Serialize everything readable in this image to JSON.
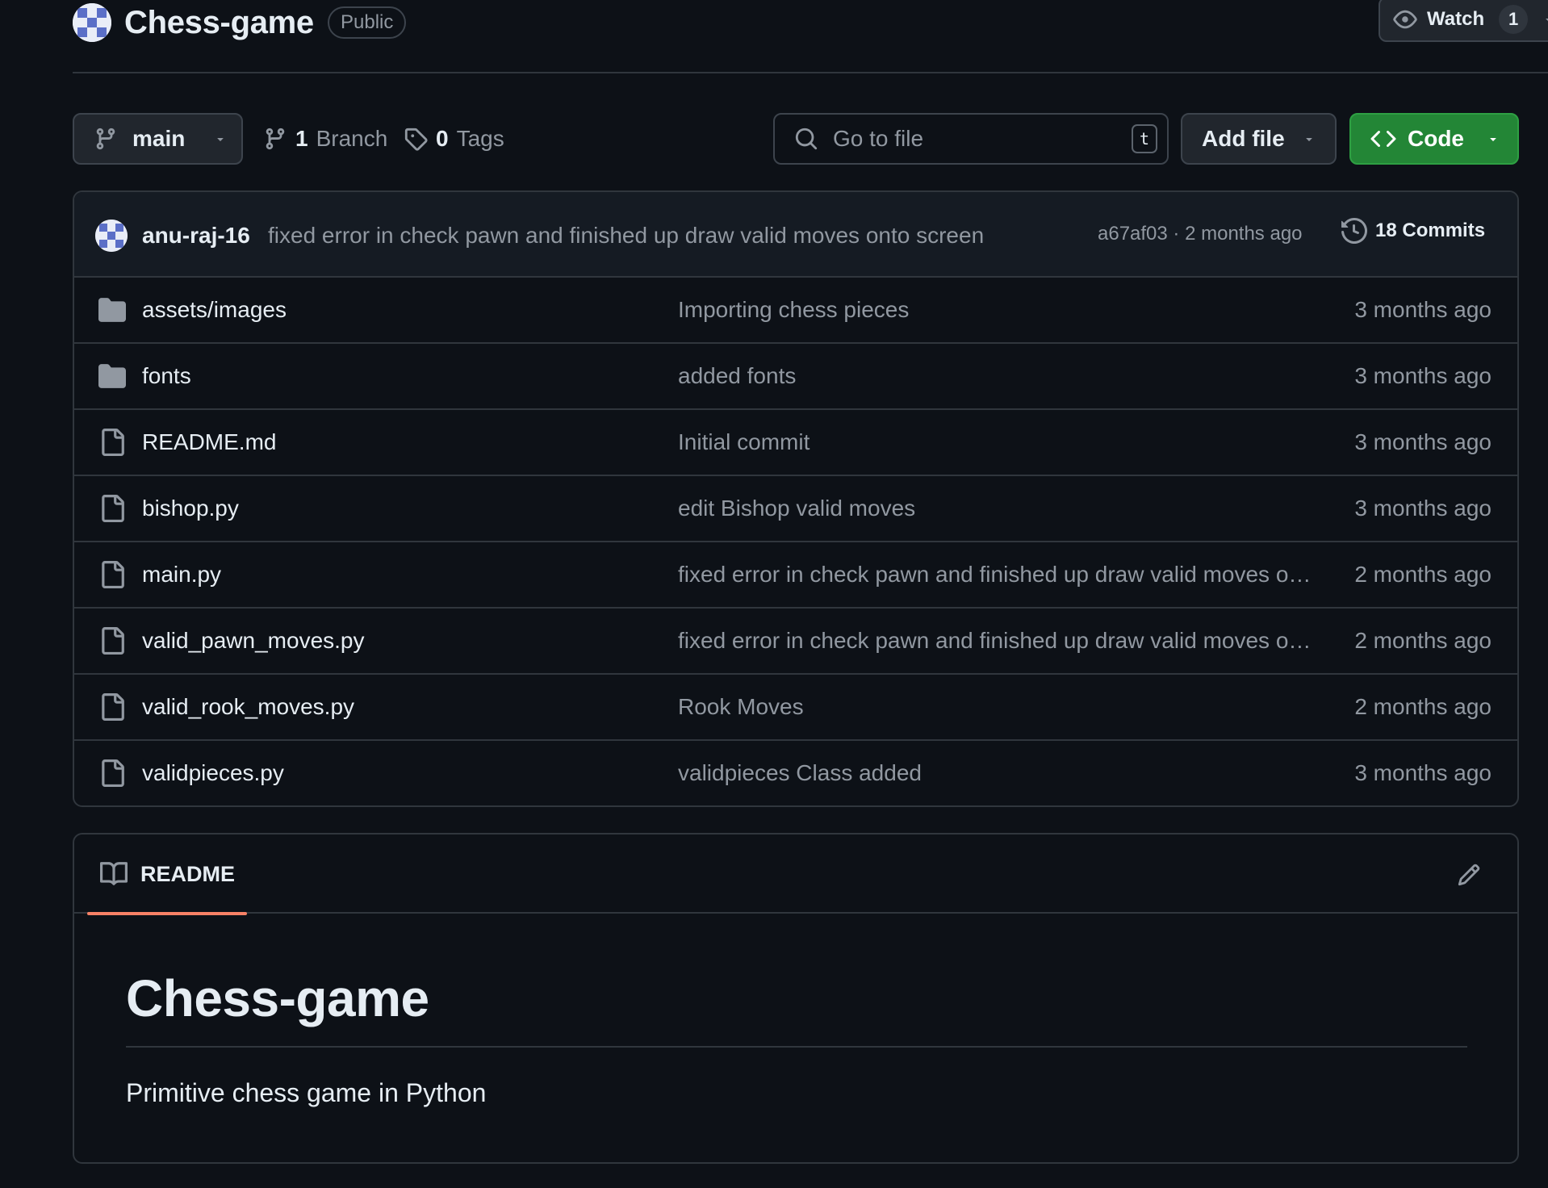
{
  "repo": {
    "name": "Chess-game",
    "visibility": "Public",
    "watch": {
      "label": "Watch",
      "count": "1"
    }
  },
  "toolbar": {
    "branch": "main",
    "branch_count": {
      "num": "1",
      "label": "Branch"
    },
    "tag_count": {
      "num": "0",
      "label": "Tags"
    },
    "search": {
      "placeholder": "Go to file",
      "shortcut": "t"
    },
    "add_file": "Add file",
    "code": "Code"
  },
  "latest_commit": {
    "author": "anu-raj-16",
    "message": "fixed error in check pawn and finished up draw valid moves onto screen",
    "meta": "a67af03 · 2 months ago",
    "commits_label": "18 Commits"
  },
  "files": [
    {
      "type": "folder",
      "icon": "folder-icon",
      "name": "assets/images",
      "message": "Importing chess pieces",
      "age": "3 months ago"
    },
    {
      "type": "folder",
      "icon": "folder-icon",
      "name": "fonts",
      "message": "added fonts",
      "age": "3 months ago"
    },
    {
      "type": "file",
      "icon": "file-icon",
      "name": "README.md",
      "message": "Initial commit",
      "age": "3 months ago"
    },
    {
      "type": "file",
      "icon": "file-icon",
      "name": "bishop.py",
      "message": "edit Bishop valid moves",
      "age": "3 months ago"
    },
    {
      "type": "file",
      "icon": "file-icon",
      "name": "main.py",
      "message": "fixed error in check pawn and finished up draw valid moves onto screen",
      "age": "2 months ago"
    },
    {
      "type": "file",
      "icon": "file-icon",
      "name": "valid_pawn_moves.py",
      "message": "fixed error in check pawn and finished up draw valid moves onto screen",
      "age": "2 months ago"
    },
    {
      "type": "file",
      "icon": "file-icon",
      "name": "valid_rook_moves.py",
      "message": "Rook Moves",
      "age": "2 months ago"
    },
    {
      "type": "file",
      "icon": "file-icon",
      "name": "validpieces.py",
      "message": "validpieces Class added",
      "age": "3 months ago"
    }
  ],
  "readme": {
    "tab_label": "README",
    "heading": "Chess-game",
    "paragraph": "Primitive chess game in Python"
  },
  "colors": {
    "background": "#0d1117",
    "border": "#30363d",
    "muted_text": "#9198a1",
    "code_button": "#238636",
    "tab_underline": "#f78166"
  }
}
